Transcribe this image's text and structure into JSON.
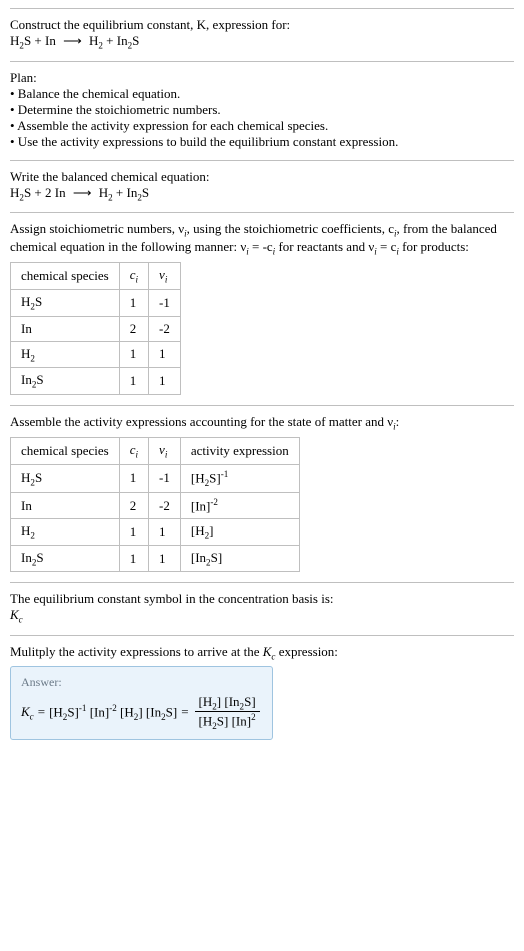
{
  "intro": {
    "line1": "Construct the equilibrium constant, K, expression for:",
    "eq_lhs1": "H",
    "eq_lhs1_sub": "2",
    "eq_lhs2": "S + In",
    "eq_arrow": "⟶",
    "eq_rhs1": "H",
    "eq_rhs1_sub": "2",
    "eq_rhs2": " + In",
    "eq_rhs2_sub": "2",
    "eq_rhs3": "S"
  },
  "plan": {
    "heading": "Plan:",
    "b1": "• Balance the chemical equation.",
    "b2": "• Determine the stoichiometric numbers.",
    "b3": "• Assemble the activity expression for each chemical species.",
    "b4": "• Use the activity expressions to build the equilibrium constant expression."
  },
  "balanced": {
    "heading": "Write the balanced chemical equation:",
    "lhs1": "H",
    "lhs1_sub": "2",
    "lhs2": "S + 2 In",
    "arrow": "⟶",
    "rhs1": "H",
    "rhs1_sub": "2",
    "rhs2": " + In",
    "rhs2_sub": "2",
    "rhs3": "S"
  },
  "assign": {
    "text1": "Assign stoichiometric numbers, ν",
    "text1_sub": "i",
    "text2": ", using the stoichiometric coefficients, c",
    "text2_sub": "i",
    "text3": ", from the balanced chemical equation in the following manner: ν",
    "text3_sub": "i",
    "text4": " = -c",
    "text4_sub": "i",
    "text5": " for reactants and ν",
    "text5_sub": "i",
    "text6": " = c",
    "text6_sub": "i",
    "text7": " for products:"
  },
  "table1": {
    "h1": "chemical species",
    "h2": "c",
    "h2_sub": "i",
    "h3": "ν",
    "h3_sub": "i",
    "r1c1a": "H",
    "r1c1b": "2",
    "r1c1c": "S",
    "r1c2": "1",
    "r1c3": "-1",
    "r2c1": "In",
    "r2c2": "2",
    "r2c3": "-2",
    "r3c1a": "H",
    "r3c1b": "2",
    "r3c2": "1",
    "r3c3": "1",
    "r4c1a": "In",
    "r4c1b": "2",
    "r4c1c": "S",
    "r4c2": "1",
    "r4c3": "1"
  },
  "assemble": {
    "text": "Assemble the activity expressions accounting for the state of matter and ν",
    "sub": "i",
    "suffix": ":"
  },
  "table2": {
    "h1": "chemical species",
    "h2": "c",
    "h2_sub": "i",
    "h3": "ν",
    "h3_sub": "i",
    "h4": "activity expression",
    "r1c1a": "H",
    "r1c1b": "2",
    "r1c1c": "S",
    "r1c2": "1",
    "r1c3": "-1",
    "r1c4a": "[H",
    "r1c4b": "2",
    "r1c4c": "S]",
    "r1c4_sup": "-1",
    "r2c1": "In",
    "r2c2": "2",
    "r2c3": "-2",
    "r2c4a": "[In]",
    "r2c4_sup": "-2",
    "r3c1a": "H",
    "r3c1b": "2",
    "r3c2": "1",
    "r3c3": "1",
    "r3c4a": "[H",
    "r3c4b": "2",
    "r3c4c": "]",
    "r4c1a": "In",
    "r4c1b": "2",
    "r4c1c": "S",
    "r4c2": "1",
    "r4c3": "1",
    "r4c4a": "[In",
    "r4c4b": "2",
    "r4c4c": "S]"
  },
  "symbol": {
    "line1": "The equilibrium constant symbol in the concentration basis is:",
    "kc": "K",
    "kc_sub": "c"
  },
  "multiply": {
    "text1": "Mulitply the activity expressions to arrive at the ",
    "kc": "K",
    "kc_sub": "c",
    "text2": " expression:"
  },
  "answer": {
    "label": "Answer:",
    "kc": "K",
    "kc_sub": "c",
    "eq": " = ",
    "t1a": "[H",
    "t1b": "2",
    "t1c": "S]",
    "t1_sup": "-1",
    "t2a": " [In]",
    "t2_sup": "-2",
    "t3a": " [H",
    "t3b": "2",
    "t3c": "]",
    "t4a": " [In",
    "t4b": "2",
    "t4c": "S]",
    "eq2": " = ",
    "num1a": "[H",
    "num1b": "2",
    "num1c": "] [In",
    "num1d": "2",
    "num1e": "S]",
    "den1a": "[H",
    "den1b": "2",
    "den1c": "S] [In]",
    "den1_sup": "2"
  },
  "chart_data": {
    "type": "table",
    "tables": [
      {
        "columns": [
          "chemical species",
          "c_i",
          "ν_i"
        ],
        "rows": [
          [
            "H2S",
            1,
            -1
          ],
          [
            "In",
            2,
            -2
          ],
          [
            "H2",
            1,
            1
          ],
          [
            "In2S",
            1,
            1
          ]
        ]
      },
      {
        "columns": [
          "chemical species",
          "c_i",
          "ν_i",
          "activity expression"
        ],
        "rows": [
          [
            "H2S",
            1,
            -1,
            "[H2S]^-1"
          ],
          [
            "In",
            2,
            -2,
            "[In]^-2"
          ],
          [
            "H2",
            1,
            1,
            "[H2]"
          ],
          [
            "In2S",
            1,
            1,
            "[In2S]"
          ]
        ]
      }
    ]
  }
}
